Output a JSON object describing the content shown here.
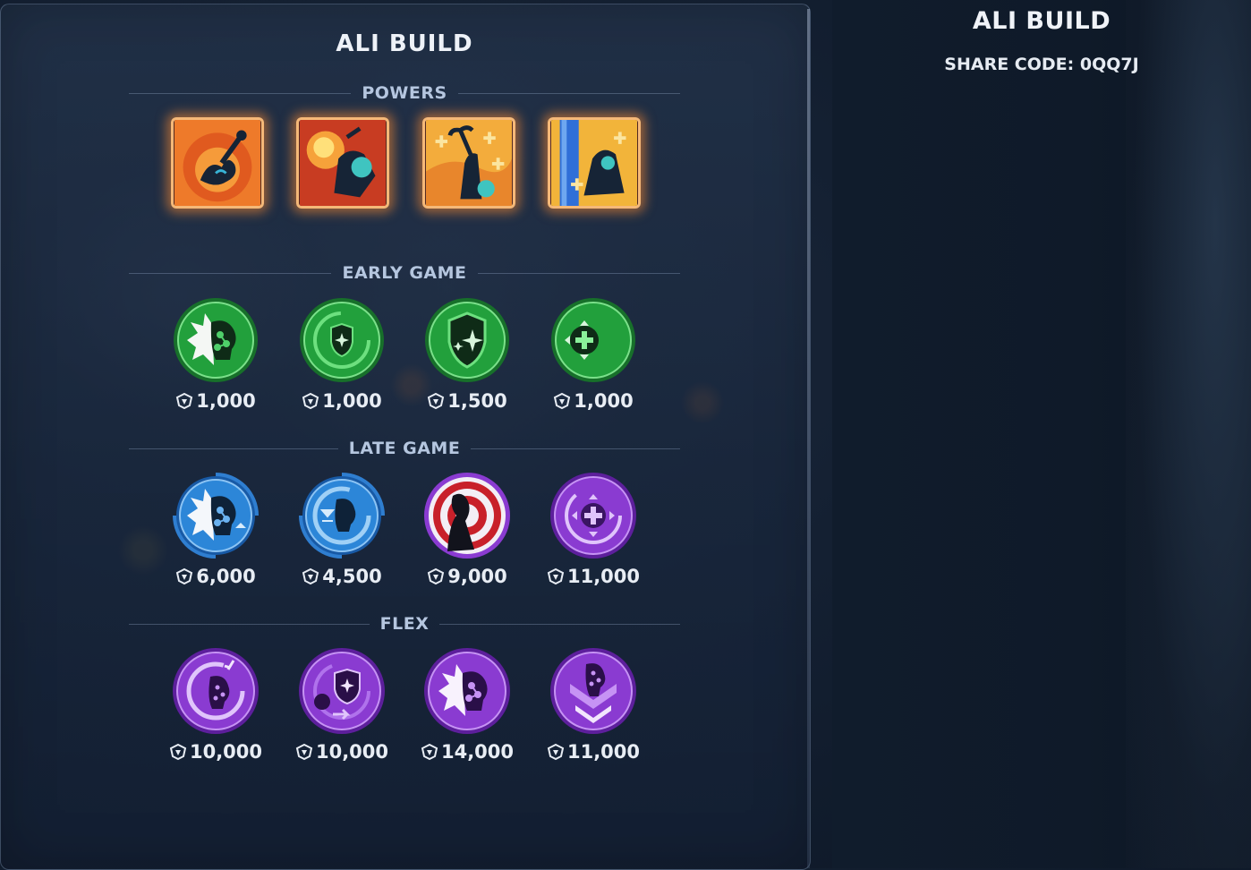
{
  "build": {
    "title": "ALI BUILD"
  },
  "sections": {
    "powers": "POWERS",
    "early_game": "EARLY GAME",
    "late_game": "LATE GAME",
    "flex": "FLEX"
  },
  "powers": [
    {
      "icon": "power-ground-slam-icon",
      "colors": [
        "#f07d2a",
        "#d24a1c"
      ]
    },
    {
      "icon": "power-fire-blast-icon",
      "colors": [
        "#e2502a",
        "#b02c1c"
      ]
    },
    {
      "icon": "power-healing-strike-icon",
      "colors": [
        "#f5b03c",
        "#e8822a"
      ]
    },
    {
      "icon": "power-barrier-icon",
      "colors": [
        "#f2b43a",
        "#2f6fd8"
      ]
    }
  ],
  "early_game": [
    {
      "icon": "ability-burst-icon",
      "cost": "1,000",
      "tier": "green"
    },
    {
      "icon": "shield-cooldown-icon",
      "cost": "1,000",
      "tier": "green"
    },
    {
      "icon": "shield-sparkle-icon",
      "cost": "1,500",
      "tier": "green"
    },
    {
      "icon": "healing-crosshair-icon",
      "cost": "1,000",
      "tier": "green"
    }
  ],
  "late_game": [
    {
      "icon": "ability-burst-icon",
      "cost": "6,000",
      "tier": "blue"
    },
    {
      "icon": "ability-cooldown-icon",
      "cost": "4,500",
      "tier": "blue"
    },
    {
      "icon": "hero-target-icon",
      "cost": "9,000",
      "tier": "purple"
    },
    {
      "icon": "healing-crosshair-icon",
      "cost": "11,000",
      "tier": "purple"
    }
  ],
  "flex": [
    {
      "icon": "ability-cooldown-icon",
      "cost": "10,000",
      "tier": "purple"
    },
    {
      "icon": "shield-cooldown-icon",
      "cost": "10,000",
      "tier": "purple"
    },
    {
      "icon": "ability-burst-icon",
      "cost": "14,000",
      "tier": "purple"
    },
    {
      "icon": "ability-down-icon",
      "cost": "11,000",
      "tier": "purple"
    }
  ],
  "tier_colors": {
    "green": "#1f9a3a",
    "blue": "#2f7ed0",
    "purple": "#8a3bd1"
  },
  "currency_icon": "stadium-cash-icon",
  "share": {
    "title": "ALI BUILD",
    "code_text": "SHARE CODE: 0QQ7J"
  }
}
